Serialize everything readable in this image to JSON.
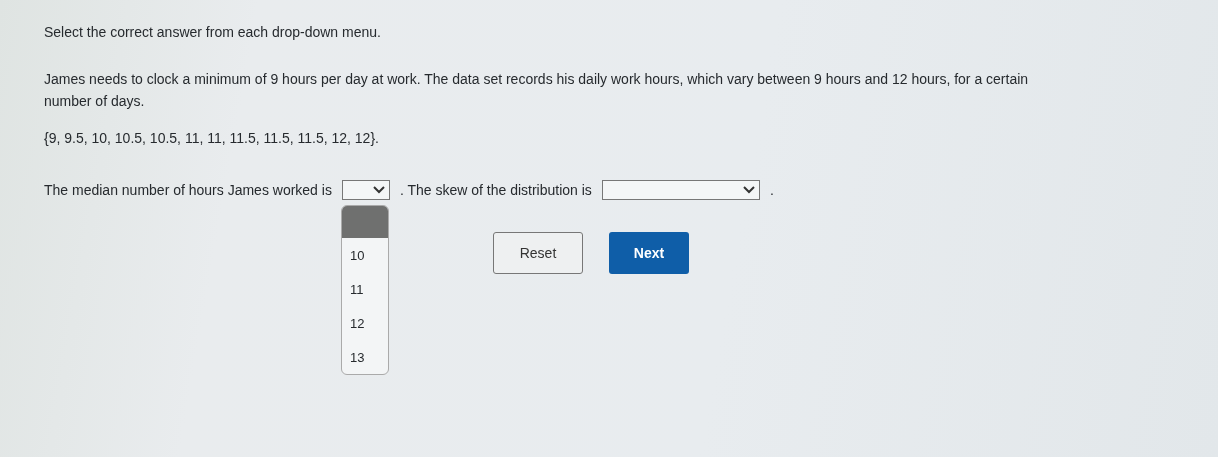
{
  "instruction": "Select the correct answer from each drop-down menu.",
  "problem": "James needs to clock a minimum of 9 hours per day at work. The data set records his daily work hours, which vary between 9 hours and 12 hours, for a certain number of days.",
  "data_set": "{9, 9.5, 10, 10.5, 10.5, 11, 11, 11.5, 11.5, 11.5, 12, 12}.",
  "sentence": [
    {
      "kind": "text",
      "text": "The median number of hours James worked is"
    },
    {
      "kind": "select",
      "open": true,
      "blank_highlighted": true,
      "options": [
        {
          "label": "10",
          "selected": false
        },
        {
          "label": "11",
          "selected": false
        },
        {
          "label": "12",
          "selected": false
        },
        {
          "label": "13",
          "selected": false
        }
      ]
    },
    {
      "kind": "text",
      "text": ". The skew of the distribution is"
    },
    {
      "kind": "wide_select"
    },
    {
      "kind": "text",
      "text": "."
    }
  ],
  "buttons": [
    {
      "label": "Reset",
      "kind": "secondary"
    },
    {
      "label": "Next",
      "kind": "primary"
    }
  ]
}
